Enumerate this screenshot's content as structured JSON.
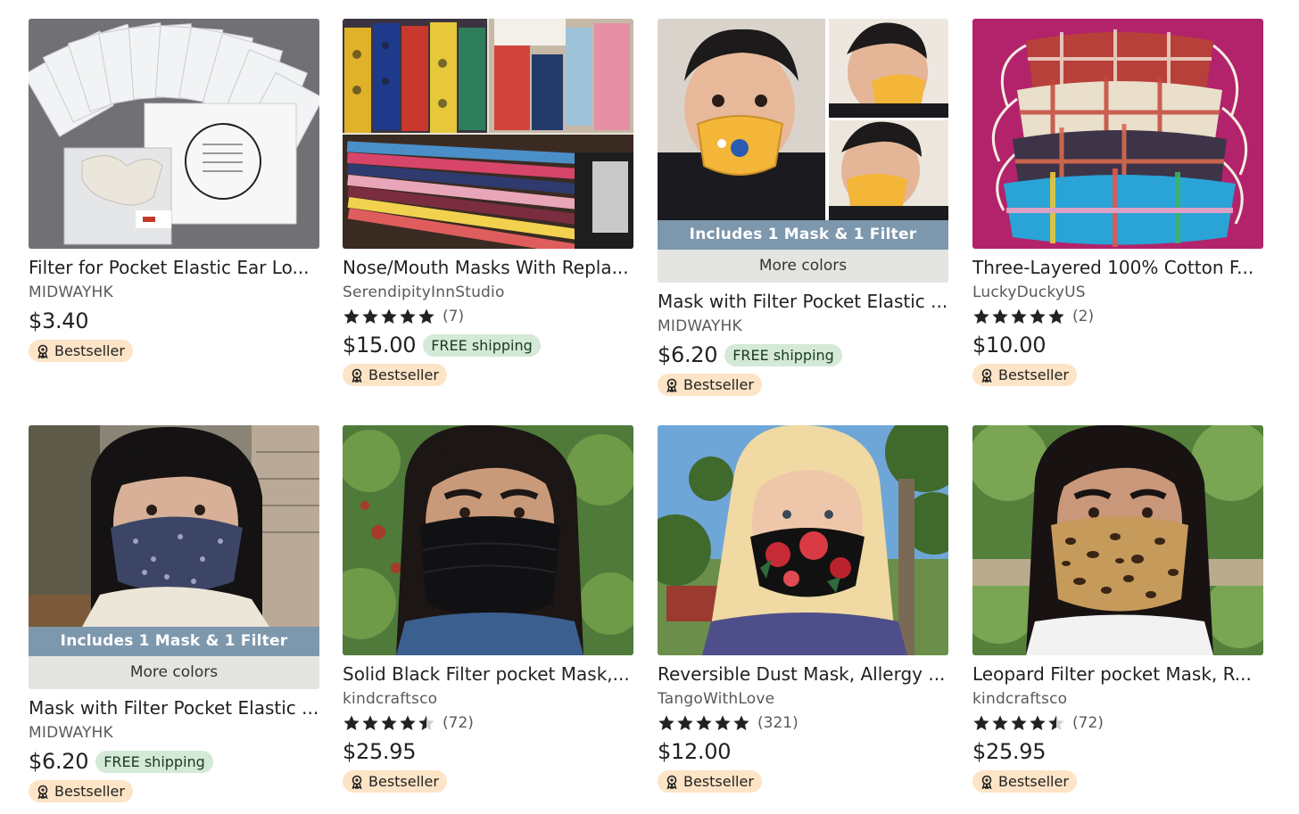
{
  "listings": [
    {
      "title": "Filter for Pocket Elastic Ear Lo...",
      "shop": "MIDWAYHK",
      "price": "$3.40",
      "badge": "Bestseller",
      "image_icon": "filter-packets-image"
    },
    {
      "title": "Nose/Mouth Masks With Repla...",
      "shop": "SerendipityInnStudio",
      "rating": 5,
      "review_count": "(7)",
      "price": "$15.00",
      "shipping": "FREE shipping",
      "badge": "Bestseller",
      "image_icon": "fabric-masks-collage-image"
    },
    {
      "title": "Mask with Filter Pocket Elastic ...",
      "shop": "MIDWAYHK",
      "overlay": "Includes 1 Mask & 1 Filter",
      "more_colors": "More colors",
      "price": "$6.20",
      "shipping": "FREE shipping",
      "badge": "Bestseller",
      "image_icon": "child-mask-image"
    },
    {
      "title": "Three-Layered 100% Cotton F...",
      "shop": "LuckyDuckyUS",
      "rating": 5,
      "review_count": "(2)",
      "price": "$10.00",
      "badge": "Bestseller",
      "image_icon": "plaid-masks-image"
    },
    {
      "title": "Mask with Filter Pocket Elastic ...",
      "shop": "MIDWAYHK",
      "overlay": "Includes 1 Mask & 1 Filter",
      "more_colors": "More colors",
      "price": "$6.20",
      "shipping": "FREE shipping",
      "badge": "Bestseller",
      "image_icon": "woman-floral-mask-image"
    },
    {
      "title": "Solid Black Filter pocket Mask,...",
      "shop": "kindcraftsco",
      "rating": 4.5,
      "review_count": "(72)",
      "price": "$25.95",
      "badge": "Bestseller",
      "image_icon": "woman-black-mask-image"
    },
    {
      "title": "Reversible Dust Mask, Allergy ...",
      "shop": "TangoWithLove",
      "rating": 5,
      "review_count": "(321)",
      "price": "$12.00",
      "badge": "Bestseller",
      "image_icon": "woman-rose-mask-image"
    },
    {
      "title": "Leopard Filter pocket Mask, R...",
      "shop": "kindcraftsco",
      "rating": 4.5,
      "review_count": "(72)",
      "price": "$25.95",
      "badge": "Bestseller",
      "image_icon": "woman-leopard-mask-image"
    }
  ],
  "colors": {
    "badge_bg": "#fde4c6",
    "free_shipping_bg": "#d4e9d7",
    "overlay_band": "#7d97ad",
    "more_colors_bg": "#e4e4e1",
    "text": "#222222",
    "muted": "#595959"
  }
}
